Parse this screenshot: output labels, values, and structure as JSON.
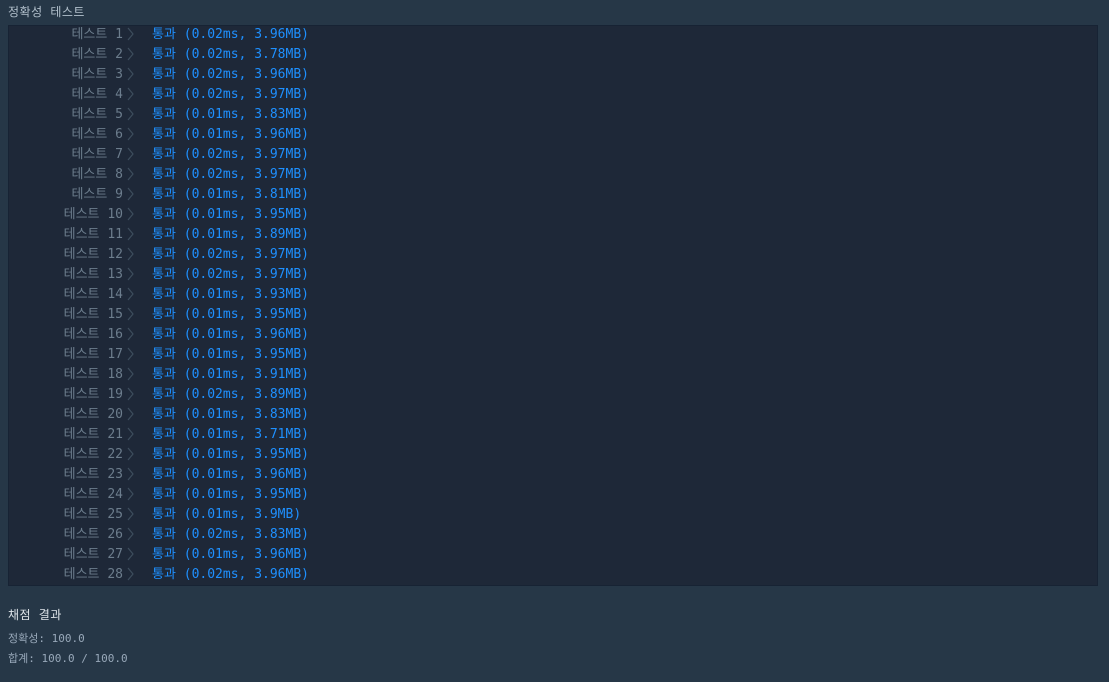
{
  "header": {
    "title": "정확성  테스트"
  },
  "results": [
    {
      "label": "테스트 1",
      "status": "통과",
      "detail": "(0.02ms, 3.96MB)"
    },
    {
      "label": "테스트 2",
      "status": "통과",
      "detail": "(0.02ms, 3.78MB)"
    },
    {
      "label": "테스트 3",
      "status": "통과",
      "detail": "(0.02ms, 3.96MB)"
    },
    {
      "label": "테스트 4",
      "status": "통과",
      "detail": "(0.02ms, 3.97MB)"
    },
    {
      "label": "테스트 5",
      "status": "통과",
      "detail": "(0.01ms, 3.83MB)"
    },
    {
      "label": "테스트 6",
      "status": "통과",
      "detail": "(0.01ms, 3.96MB)"
    },
    {
      "label": "테스트 7",
      "status": "통과",
      "detail": "(0.02ms, 3.97MB)"
    },
    {
      "label": "테스트 8",
      "status": "통과",
      "detail": "(0.02ms, 3.97MB)"
    },
    {
      "label": "테스트 9",
      "status": "통과",
      "detail": "(0.01ms, 3.81MB)"
    },
    {
      "label": "테스트 10",
      "status": "통과",
      "detail": "(0.01ms, 3.95MB)"
    },
    {
      "label": "테스트 11",
      "status": "통과",
      "detail": "(0.01ms, 3.89MB)"
    },
    {
      "label": "테스트 12",
      "status": "통과",
      "detail": "(0.02ms, 3.97MB)"
    },
    {
      "label": "테스트 13",
      "status": "통과",
      "detail": "(0.02ms, 3.97MB)"
    },
    {
      "label": "테스트 14",
      "status": "통과",
      "detail": "(0.01ms, 3.93MB)"
    },
    {
      "label": "테스트 15",
      "status": "통과",
      "detail": "(0.01ms, 3.95MB)"
    },
    {
      "label": "테스트 16",
      "status": "통과",
      "detail": "(0.01ms, 3.96MB)"
    },
    {
      "label": "테스트 17",
      "status": "통과",
      "detail": "(0.01ms, 3.95MB)"
    },
    {
      "label": "테스트 18",
      "status": "통과",
      "detail": "(0.01ms, 3.91MB)"
    },
    {
      "label": "테스트 19",
      "status": "통과",
      "detail": "(0.02ms, 3.89MB)"
    },
    {
      "label": "테스트 20",
      "status": "통과",
      "detail": "(0.01ms, 3.83MB)"
    },
    {
      "label": "테스트 21",
      "status": "통과",
      "detail": "(0.01ms, 3.71MB)"
    },
    {
      "label": "테스트 22",
      "status": "통과",
      "detail": "(0.01ms, 3.95MB)"
    },
    {
      "label": "테스트 23",
      "status": "통과",
      "detail": "(0.01ms, 3.96MB)"
    },
    {
      "label": "테스트 24",
      "status": "통과",
      "detail": "(0.01ms, 3.95MB)"
    },
    {
      "label": "테스트 25",
      "status": "통과",
      "detail": "(0.01ms, 3.9MB)"
    },
    {
      "label": "테스트 26",
      "status": "통과",
      "detail": "(0.02ms, 3.83MB)"
    },
    {
      "label": "테스트 27",
      "status": "통과",
      "detail": "(0.01ms, 3.96MB)"
    },
    {
      "label": "테스트 28",
      "status": "통과",
      "detail": "(0.02ms, 3.96MB)"
    }
  ],
  "summary": {
    "title": "채점 결과",
    "accuracy_label": "정확성:",
    "accuracy_value": "100.0",
    "total_label": "합계:",
    "total_value": "100.0 / 100.0"
  },
  "colors": {
    "background": "#263747",
    "panel": "#1e2838",
    "pass_text": "#1e90ff",
    "label_text": "#6c7d8d"
  },
  "icons": {
    "row_separator": "chevron-right-icon"
  }
}
